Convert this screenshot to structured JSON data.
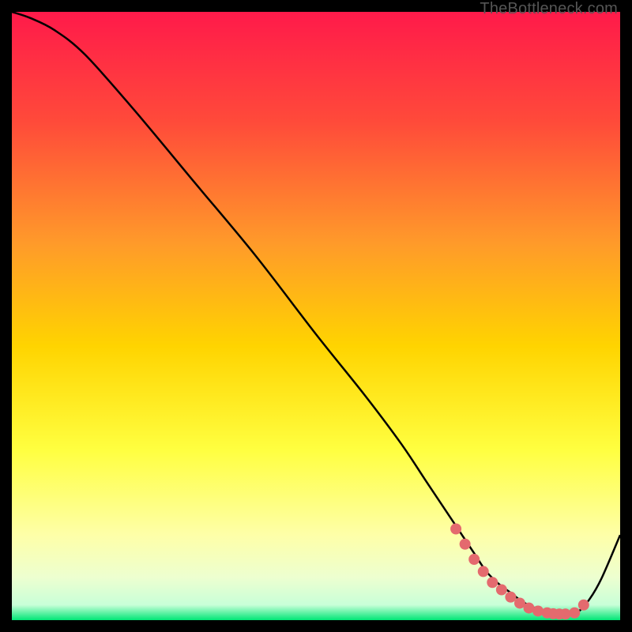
{
  "watermark": "TheBottleneck.com",
  "colors": {
    "top": "#ff1a4a",
    "upper_mid": "#ff7a2a",
    "mid": "#ffd400",
    "lower_mid": "#ffff66",
    "pale": "#f3ffcc",
    "green": "#00e676",
    "curve": "#000000",
    "marker": "#e46a6e"
  },
  "chart_data": {
    "type": "line",
    "title": "",
    "xlabel": "",
    "ylabel": "",
    "xlim": [
      0,
      100
    ],
    "ylim": [
      0,
      100
    ],
    "curve": {
      "name": "bottleneck-curve",
      "x": [
        0,
        3,
        7,
        12,
        20,
        30,
        40,
        50,
        58,
        64,
        68,
        72,
        74,
        76,
        78,
        80,
        82,
        84,
        86,
        88,
        90,
        91.5,
        93,
        95,
        97,
        100
      ],
      "y": [
        100,
        99,
        97,
        93,
        84,
        72,
        60,
        47,
        37,
        29,
        23,
        17,
        14,
        11,
        8,
        6,
        4.5,
        3,
        2,
        1.3,
        1,
        1,
        1.3,
        3.5,
        7,
        14
      ]
    },
    "markers": {
      "name": "highlight-points",
      "x": [
        73,
        74.5,
        76,
        77.5,
        79,
        80.5,
        82,
        83.5,
        85,
        86.5,
        88,
        89,
        90,
        91,
        92.5,
        94
      ],
      "y": [
        15,
        12.5,
        10,
        8,
        6.2,
        5,
        3.8,
        2.8,
        2,
        1.5,
        1.2,
        1.05,
        1,
        1,
        1.2,
        2.5
      ]
    }
  }
}
